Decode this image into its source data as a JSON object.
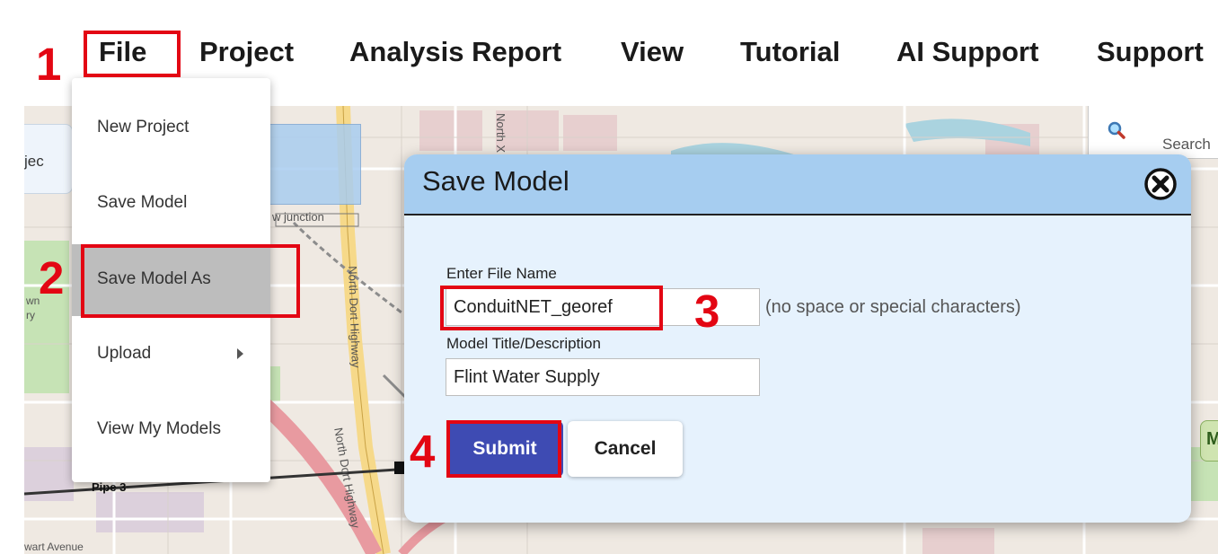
{
  "menu": {
    "items": [
      {
        "label": "File"
      },
      {
        "label": "Project"
      },
      {
        "label": "Analysis Report"
      },
      {
        "label": "View"
      },
      {
        "label": "Tutorial"
      },
      {
        "label": "AI Support"
      },
      {
        "label": "Support"
      }
    ]
  },
  "file_menu": {
    "items": [
      {
        "label": "New Project"
      },
      {
        "label": "Save Model"
      },
      {
        "label": "Save Model As"
      },
      {
        "label": "Upload"
      },
      {
        "label": "View My Models"
      }
    ]
  },
  "map": {
    "project_tab_fragment": "jec",
    "label_north_x": "North X",
    "label_north_dort": "North Dort Highway",
    "label_north_dort_2": "North Dort Highway",
    "label_junction": "w junction",
    "label_pipe": "Pipe 3",
    "label_avenue": "wart Avenue",
    "label_left": "wn",
    "label_left2": "ry",
    "search_placeholder": "Search",
    "chip_letter": "M"
  },
  "dialog": {
    "title": "Save Model",
    "file_name_label": "Enter File Name",
    "file_name_value": "ConduitNET_georef",
    "file_name_hint": "(no space or special characters)",
    "description_label": "Model Title/Description",
    "description_value": "Flint Water Supply",
    "submit_label": "Submit",
    "cancel_label": "Cancel"
  },
  "annotations": {
    "step1": "1",
    "step2": "2",
    "step3": "3",
    "step4": "4",
    "color": "#e30613"
  },
  "colors": {
    "dialog_header": "#a6cdf0",
    "dialog_body": "#e6f2fd",
    "submit_button": "#3e4bb3",
    "menu_active": "#bdbdbd"
  }
}
